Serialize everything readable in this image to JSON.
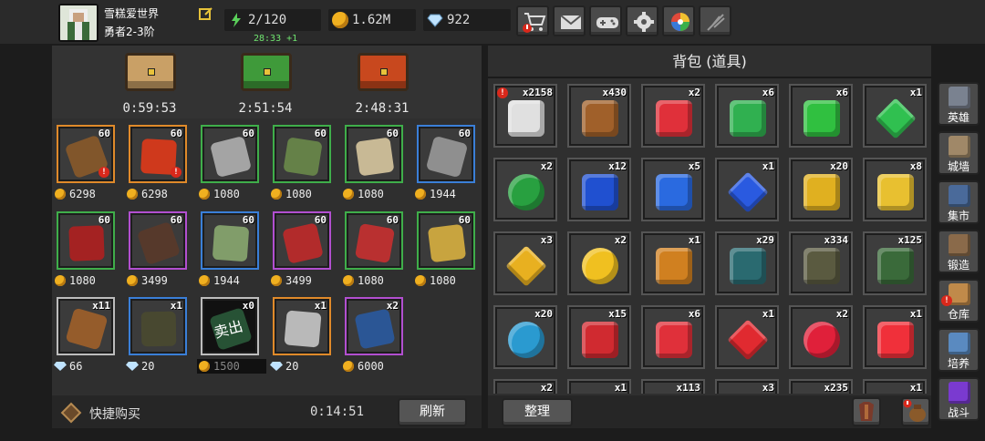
{
  "player": {
    "name": "雪糕爱世界",
    "rank": "勇者2-3阶"
  },
  "resources": {
    "energy": "2/120",
    "energy_timer": "28:33 +1",
    "gold": "1.62M",
    "gems": "922"
  },
  "top_buttons": [
    "shop-cart-icon",
    "mail-icon",
    "gamepad-icon",
    "gear-icon",
    "color-wheel-icon",
    "feather-icon"
  ],
  "chests": [
    {
      "timer": "0:59:53",
      "color": "#c9a066"
    },
    {
      "timer": "2:51:54",
      "color": "#3f9a3a"
    },
    {
      "timer": "2:48:31",
      "color": "#c8481e"
    }
  ],
  "shop_items": [
    {
      "count": "60",
      "price": "6298",
      "currency": "coin",
      "grade": "g-orange",
      "icon": "staff-icon",
      "color": "#8a5a2a",
      "warn": true
    },
    {
      "count": "60",
      "price": "6298",
      "currency": "coin",
      "grade": "g-orange",
      "icon": "fire-orb-icon",
      "color": "#e03a1a",
      "warn": true
    },
    {
      "count": "60",
      "price": "1080",
      "currency": "coin",
      "grade": "g-green",
      "icon": "knife-icon",
      "color": "#b0b0b0"
    },
    {
      "count": "60",
      "price": "1080",
      "currency": "coin",
      "grade": "g-green",
      "icon": "bow-icon",
      "color": "#6a8a4a"
    },
    {
      "count": "60",
      "price": "1080",
      "currency": "coin",
      "grade": "g-green",
      "icon": "scimitar-icon",
      "color": "#d8c8a0"
    },
    {
      "count": "60",
      "price": "1944",
      "currency": "coin",
      "grade": "g-blue",
      "icon": "mace-icon",
      "color": "#999"
    },
    {
      "count": "60",
      "price": "1080",
      "currency": "coin",
      "grade": "g-green",
      "icon": "helmet-icon",
      "color": "#b02020"
    },
    {
      "count": "60",
      "price": "3499",
      "currency": "coin",
      "grade": "g-purple",
      "icon": "armor-icon",
      "color": "#5a3a2a"
    },
    {
      "count": "60",
      "price": "1944",
      "currency": "coin",
      "grade": "g-blue",
      "icon": "gloves-icon",
      "color": "#8aa870"
    },
    {
      "count": "60",
      "price": "3499",
      "currency": "coin",
      "grade": "g-purple",
      "icon": "leggings-icon",
      "color": "#c02a2a"
    },
    {
      "count": "60",
      "price": "1080",
      "currency": "coin",
      "grade": "g-green",
      "icon": "boots-icon",
      "color": "#c83030"
    },
    {
      "count": "60",
      "price": "1080",
      "currency": "coin",
      "grade": "g-green",
      "icon": "necklace-icon",
      "color": "#d8b040"
    },
    {
      "count": "x11",
      "price": "66",
      "currency": "gem",
      "grade": "g-white",
      "icon": "book-icon",
      "color": "#a0602a"
    },
    {
      "count": "x1",
      "price": "20",
      "currency": "gem",
      "grade": "g-blue",
      "icon": "rune-stone-icon",
      "color": "#4a4a30"
    },
    {
      "count": "x0",
      "price": "1500",
      "currency": "coin",
      "grade": "g-white",
      "icon": "sold-out-icon",
      "color": "#2a5a3a",
      "sold": "卖出"
    },
    {
      "count": "x1",
      "price": "20",
      "currency": "gem",
      "grade": "g-orange",
      "icon": "feather-blade-icon",
      "color": "#c8c8c8"
    },
    {
      "count": "x2",
      "price": "6000",
      "currency": "coin",
      "grade": "g-purple",
      "icon": "chest-icon",
      "color": "#2a5aa0"
    }
  ],
  "quick_buy": "快捷购买",
  "refresh_timer": "0:14:51",
  "refresh_label": "刷新",
  "bag_title": "背包 (道具)",
  "bag_items": [
    {
      "count": "x2158",
      "grade": "g-green",
      "icon": "treasure-chest-icon",
      "color": "#e0e0e0",
      "warn": true
    },
    {
      "count": "x430",
      "grade": "g-white",
      "icon": "book-icon",
      "color": "#a0602a"
    },
    {
      "count": "x2",
      "grade": "g-red",
      "icon": "ruby-heart-icon",
      "color": "#e0303a"
    },
    {
      "count": "x6",
      "grade": "g-white",
      "icon": "emerald-pile-icon",
      "color": "#30b050"
    },
    {
      "count": "x6",
      "grade": "g-green",
      "icon": "emerald-square-icon",
      "color": "#30c040"
    },
    {
      "count": "x1",
      "grade": "g-blue",
      "icon": "emerald-diamond-icon",
      "color": "#30c050"
    },
    {
      "count": "x2",
      "grade": "g-orange",
      "icon": "emerald-round-icon",
      "color": "#28a040"
    },
    {
      "count": "x12",
      "grade": "g-white",
      "icon": "sapphire-pile-icon",
      "color": "#2050d0"
    },
    {
      "count": "x5",
      "grade": "g-green",
      "icon": "sapphire-square-icon",
      "color": "#2a6ae0"
    },
    {
      "count": "x1",
      "grade": "g-blue",
      "icon": "sapphire-diamond-icon",
      "color": "#2a5ae0"
    },
    {
      "count": "x20",
      "grade": "g-white",
      "icon": "topaz-pile-icon",
      "color": "#e0b020"
    },
    {
      "count": "x8",
      "grade": "g-green",
      "icon": "topaz-square-icon",
      "color": "#e8c030"
    },
    {
      "count": "x3",
      "grade": "g-blue",
      "icon": "topaz-diamond-icon",
      "color": "#e8b020"
    },
    {
      "count": "x2",
      "grade": "g-purple",
      "icon": "topaz-round-icon",
      "color": "#f0c020"
    },
    {
      "count": "x1",
      "grade": "g-orange",
      "icon": "amber-rune-icon",
      "color": "#d08020"
    },
    {
      "count": "x29",
      "grade": "g-orange",
      "icon": "spellbook-icon",
      "color": "#2a6a70"
    },
    {
      "count": "x334",
      "grade": "g-blue",
      "icon": "rune-stone-icon",
      "color": "#5a5a40"
    },
    {
      "count": "x125",
      "grade": "g-purple",
      "icon": "green-rune-icon",
      "color": "#3a6a3a"
    },
    {
      "count": "x20",
      "grade": "g-red",
      "icon": "blue-orb-icon",
      "color": "#2a9ad0"
    },
    {
      "count": "x15",
      "grade": "g-white",
      "icon": "ruby-pile-icon",
      "color": "#d02a30"
    },
    {
      "count": "x6",
      "grade": "g-green",
      "icon": "ruby-square-icon",
      "color": "#e0303a"
    },
    {
      "count": "x1",
      "grade": "g-blue",
      "icon": "ruby-diamond-icon",
      "color": "#e02a30"
    },
    {
      "count": "x2",
      "grade": "g-purple",
      "icon": "ruby-round-icon",
      "color": "#e0203a"
    },
    {
      "count": "x1",
      "grade": "g-orange",
      "icon": "ruby-gem-icon",
      "color": "#f0303a"
    },
    {
      "count": "x2",
      "grade": "g-green",
      "icon": "partial-item-icon",
      "color": "#888"
    },
    {
      "count": "x1",
      "grade": "g-red",
      "icon": "partial-item-icon",
      "color": "#888"
    },
    {
      "count": "x113",
      "grade": "g-green",
      "icon": "partial-item-icon",
      "color": "#888"
    },
    {
      "count": "x3",
      "grade": "g-white",
      "icon": "partial-item-icon",
      "color": "#888"
    },
    {
      "count": "x235",
      "grade": "g-green",
      "icon": "partial-item-icon",
      "color": "#888"
    },
    {
      "count": "x1",
      "grade": "g-blue",
      "icon": "partial-item-icon",
      "color": "#888"
    }
  ],
  "sort_label": "整理",
  "sidebar": [
    {
      "label": "英雄",
      "icon": "helmet-icon",
      "color": "#7a8290"
    },
    {
      "label": "城墙",
      "icon": "castle-wall-icon",
      "color": "#a08868"
    },
    {
      "label": "集市",
      "icon": "market-stall-icon",
      "color": "#4a6a9a"
    },
    {
      "label": "锻造",
      "icon": "anvil-icon",
      "color": "#8a6a4a"
    },
    {
      "label": "仓库",
      "icon": "warehouse-icon",
      "color": "#c08a4a",
      "warn": true
    },
    {
      "label": "培养",
      "icon": "potion-icon",
      "color": "#5a8ac0"
    },
    {
      "label": "战斗",
      "icon": "portal-icon",
      "color": "#7a3ad0"
    }
  ]
}
